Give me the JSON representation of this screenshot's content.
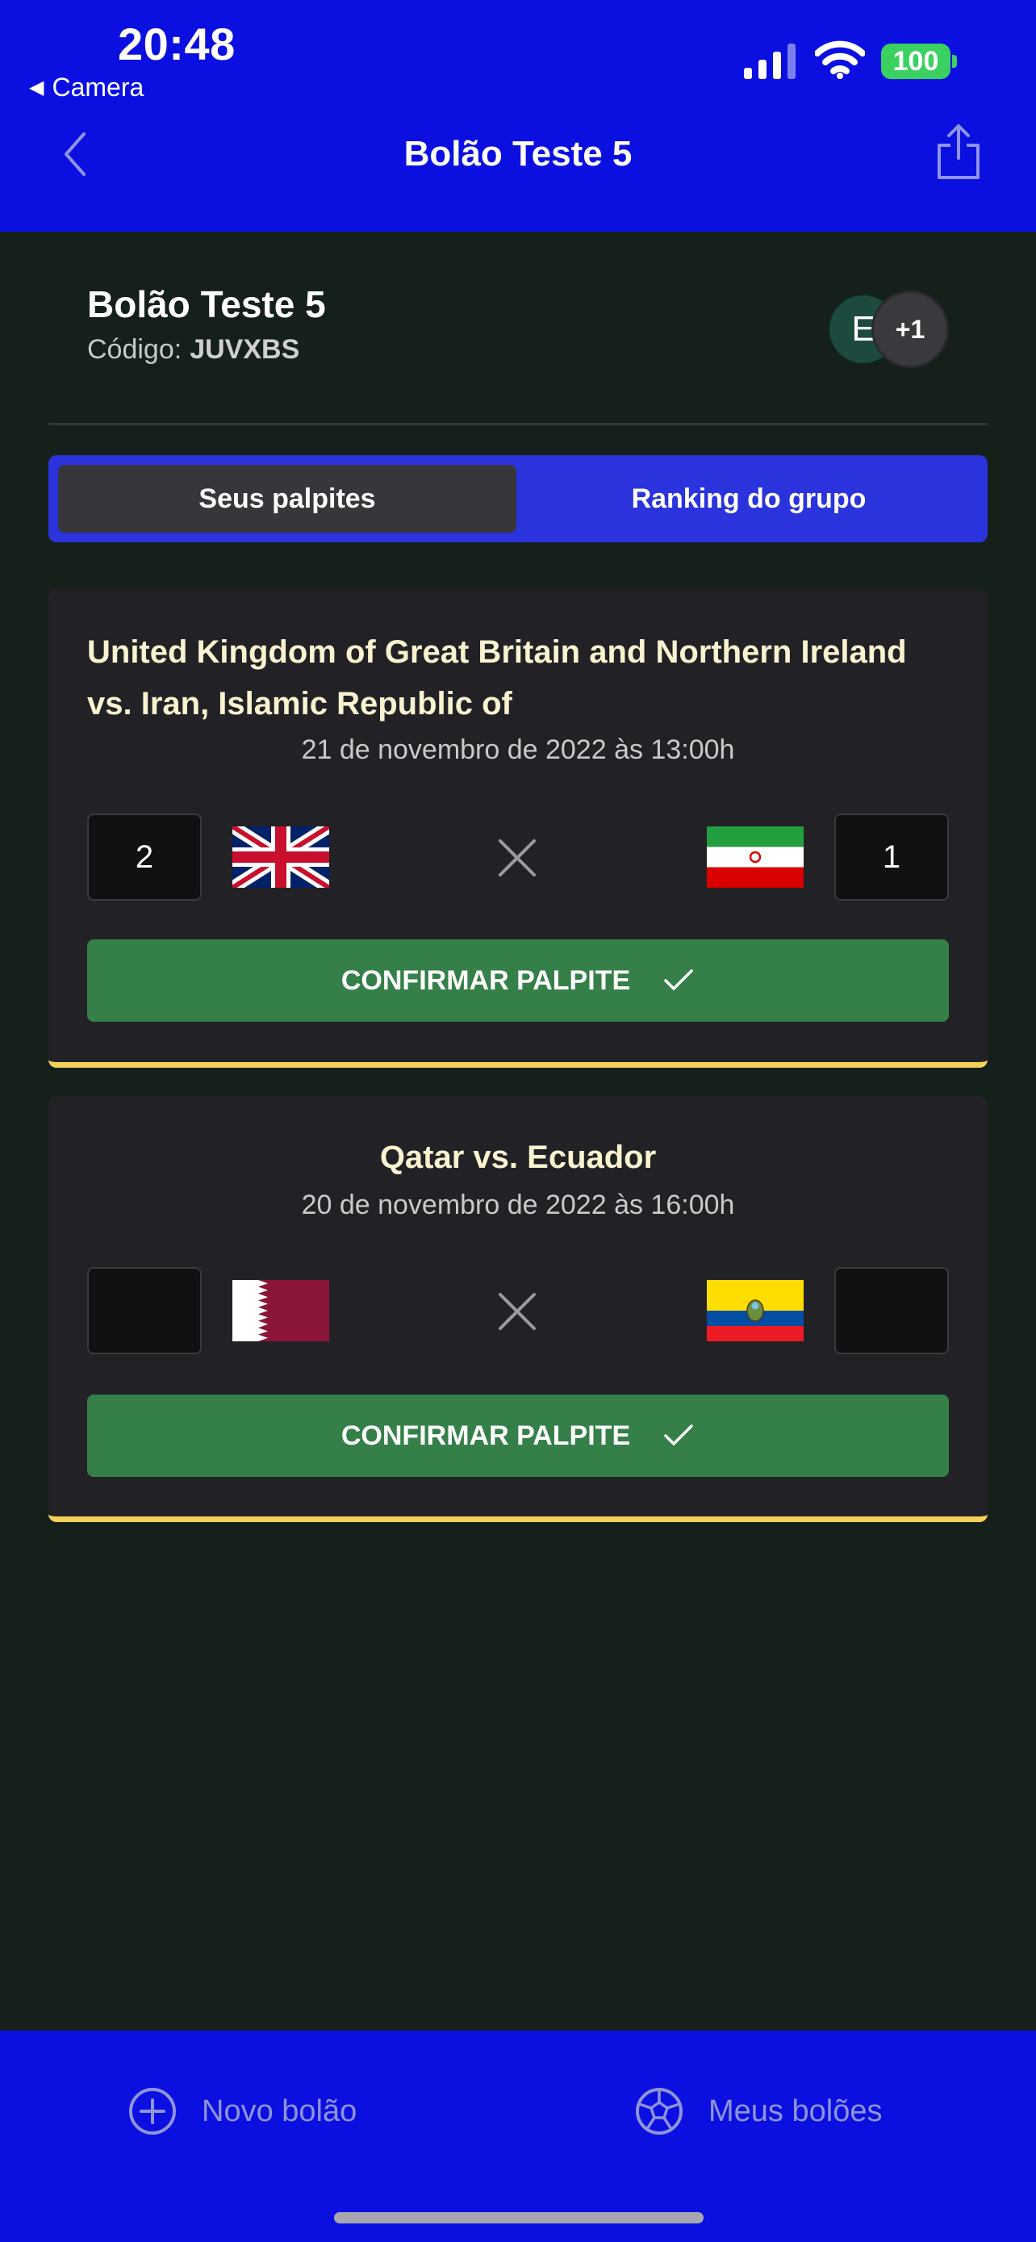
{
  "status_bar": {
    "time": "20:48",
    "back_app": "Camera",
    "battery": "100"
  },
  "nav": {
    "title": "Bolão Teste 5",
    "back_icon": "chevron-left-icon",
    "share_icon": "share-icon"
  },
  "group": {
    "name": "Bolão Teste 5",
    "code_label": "Código:",
    "code_value": "JUVXBS",
    "avatar_initial": "E",
    "avatar_more": "+1"
  },
  "tabs": [
    {
      "label": "Seus palpites",
      "active": true
    },
    {
      "label": "Ranking do grupo",
      "active": false
    }
  ],
  "matches": [
    {
      "title": "United Kingdom of Great Britain and Northern Ireland vs. Iran, Islamic Republic of",
      "date": "21 de novembro de 2022 às 13:00h",
      "home_score": "2",
      "away_score": "1",
      "home_flag": "uk-flag-icon",
      "away_flag": "iran-flag-icon",
      "confirm_label": "CONFIRMAR PALPITE"
    },
    {
      "title": "Qatar vs. Ecuador",
      "date": "20 de novembro de 2022 às 16:00h",
      "home_score": "",
      "away_score": "",
      "home_flag": "qatar-flag-icon",
      "away_flag": "ecuador-flag-icon",
      "confirm_label": "CONFIRMAR PALPITE"
    }
  ],
  "bottom_nav": {
    "new_label": "Novo bolão",
    "mine_label": "Meus bolões"
  },
  "colors": {
    "header_blue": "#0b10e0",
    "background": "#15201a",
    "card": "#222226",
    "confirm_green": "#358049",
    "card_accent_yellow": "#f2d15a",
    "title_cream": "#faf3d0"
  }
}
